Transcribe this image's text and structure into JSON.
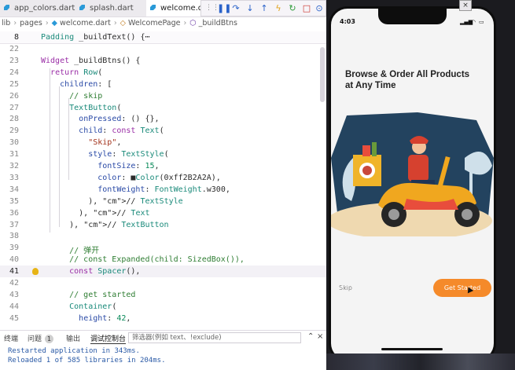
{
  "editor": {
    "tabs": [
      {
        "label": "app_colors.dart",
        "active": false
      },
      {
        "label": "splash.dart",
        "active": false
      },
      {
        "label": "welcome.da",
        "active": true
      }
    ],
    "breadcrumb": [
      "lib",
      "pages",
      "welcome.dart",
      "WelcomePage",
      "_buildBtns"
    ],
    "debug_icons": [
      "pause-icon",
      "step-over-icon",
      "step-into-icon",
      "step-out-icon",
      "hot-reload-icon",
      "restart-icon",
      "stop-icon",
      "inspect-icon"
    ],
    "sticky": {
      "line": "8",
      "text": "Padding _buildText() {⋯"
    },
    "lines": [
      {
        "n": "22",
        "text": ""
      },
      {
        "n": "23",
        "text": "Widget _buildBtns() {"
      },
      {
        "n": "24",
        "text": "  return Row("
      },
      {
        "n": "25",
        "text": "    children: ["
      },
      {
        "n": "26",
        "text": "      // skip"
      },
      {
        "n": "27",
        "text": "      TextButton("
      },
      {
        "n": "28",
        "text": "        onPressed: () {},"
      },
      {
        "n": "29",
        "text": "        child: const Text("
      },
      {
        "n": "30",
        "text": "          \"Skip\","
      },
      {
        "n": "31",
        "text": "          style: TextStyle("
      },
      {
        "n": "32",
        "text": "            fontSize: 15,"
      },
      {
        "n": "33",
        "text": "            color: ■Color(0xff2B2A2A),"
      },
      {
        "n": "34",
        "text": "            fontWeight: FontWeight.w300,"
      },
      {
        "n": "35",
        "text": "          ), // TextStyle"
      },
      {
        "n": "36",
        "text": "        ), // Text"
      },
      {
        "n": "37",
        "text": "      ), // TextButton"
      },
      {
        "n": "38",
        "text": ""
      },
      {
        "n": "39",
        "text": "      // 弹开"
      },
      {
        "n": "40",
        "text": "      // const Expanded(child: SizedBox()),"
      },
      {
        "n": "41",
        "text": "      const Spacer(),"
      },
      {
        "n": "42",
        "text": ""
      },
      {
        "n": "43",
        "text": "      // get started"
      },
      {
        "n": "44",
        "text": "      Container("
      },
      {
        "n": "45",
        "text": "        height: 42,"
      }
    ],
    "current_line": "41"
  },
  "panel": {
    "tabs": [
      {
        "label": "终端"
      },
      {
        "label": "问题",
        "badge": "1"
      },
      {
        "label": "输出"
      },
      {
        "label": "调试控制台"
      }
    ],
    "filter_placeholder": "筛选器(例如 text、!exclude)",
    "output": [
      "Restarted application in 343ms.",
      "Reloaded 1 of 585 libraries in 204ms."
    ]
  },
  "simulator": {
    "time": "4:03",
    "headline_line1": "Browse & Order All Products",
    "headline_line2": "at Any Time",
    "skip_label": "Skip",
    "start_label": "Get Started",
    "accent": "#f58a2a",
    "skip_color": "#2B2A2A"
  }
}
